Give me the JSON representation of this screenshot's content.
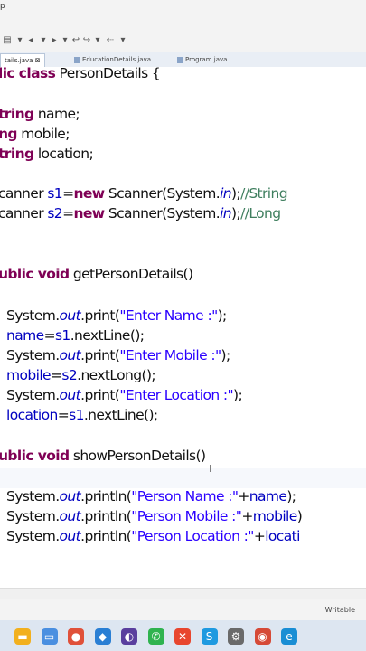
{
  "menubar": {
    "fragment": "p"
  },
  "tabs": [
    {
      "label": "tails.java",
      "active": true
    },
    {
      "label": "EducationDetails.java",
      "active": false
    },
    {
      "label": "Program.java",
      "active": false
    }
  ],
  "code": {
    "l1_kw": "lic class",
    "l1_rest": " PersonDetails {",
    "l2_type": "tring",
    "l2_rest": " name;",
    "l3_type": "ng",
    "l3_rest": " mobile;",
    "l4_type": "tring",
    "l4_rest": " location;",
    "l5_a": "canner ",
    "l5_b": "s1",
    "l5_c": "=",
    "l5_d": "new",
    "l5_e": " Scanner(System.",
    "l5_f": "in",
    "l5_g": ");",
    "l5_h": "//String",
    "l6_a": "canner ",
    "l6_b": "s2",
    "l6_c": "=",
    "l6_d": "new",
    "l6_e": " Scanner(System.",
    "l6_f": "in",
    "l6_g": ");",
    "l6_h": "//Long",
    "l7_kw": "ublic void",
    "l7_rest": " getPersonDetails()",
    "l8_a": "System.",
    "l8_b": "out",
    "l8_c": ".print(",
    "l8_d": "\"Enter Name :\"",
    "l8_e": ");",
    "l9_a": "name",
    "l9_b": "=",
    "l9_c": "s1",
    "l9_d": ".nextLine();",
    "l10_a": "System.",
    "l10_b": "out",
    "l10_c": ".print(",
    "l10_d": "\"Enter Mobile :\"",
    "l10_e": ");",
    "l11_a": "mobile",
    "l11_b": "=",
    "l11_c": "s2",
    "l11_d": ".nextLong();",
    "l12_a": "System.",
    "l12_b": "out",
    "l12_c": ".print(",
    "l12_d": "\"Enter Location :\"",
    "l12_e": ");",
    "l13_a": "location",
    "l13_b": "=",
    "l13_c": "s1",
    "l13_d": ".nextLine();",
    "l14_kw": "ublic void",
    "l14_rest": " showPersonDetails()",
    "l15_a": "System.",
    "l15_b": "out",
    "l15_c": ".println(",
    "l15_d": "\"Person Name :\"",
    "l15_e": "+",
    "l15_f": "name",
    "l15_g": ");",
    "l16_a": "System.",
    "l16_b": "out",
    "l16_c": ".println(",
    "l16_d": "\"Person Mobile :\"",
    "l16_e": "+",
    "l16_f": "mobile",
    "l16_g": ")",
    "l17_a": "System.",
    "l17_b": "out",
    "l17_c": ".println(",
    "l17_d": "\"Person Location :\"",
    "l17_e": "+",
    "l17_f": "locati"
  },
  "status": {
    "mode": "Writable"
  },
  "taskbar": [
    {
      "name": "file-explorer-icon",
      "color": "#f2b01e",
      "glyph": "▬"
    },
    {
      "name": "mail-icon",
      "color": "#4a8fe0",
      "glyph": "▭"
    },
    {
      "name": "browser-icon",
      "color": "#e0513a",
      "glyph": "●"
    },
    {
      "name": "vscode-icon",
      "color": "#2a7fd4",
      "glyph": "◆"
    },
    {
      "name": "eclipse-icon",
      "color": "#5a3f9e",
      "glyph": "◐"
    },
    {
      "name": "whatsapp-icon",
      "color": "#2fb34f",
      "glyph": "✆"
    },
    {
      "name": "app-icon",
      "color": "#e8462e",
      "glyph": "✕"
    },
    {
      "name": "skype-icon",
      "color": "#1f9ae0",
      "glyph": "S"
    },
    {
      "name": "settings-icon",
      "color": "#6a6a6a",
      "glyph": "⚙"
    },
    {
      "name": "chrome-icon",
      "color": "#d64a37",
      "glyph": "◉"
    },
    {
      "name": "edge-icon",
      "color": "#1a8ed4",
      "glyph": "e"
    }
  ]
}
